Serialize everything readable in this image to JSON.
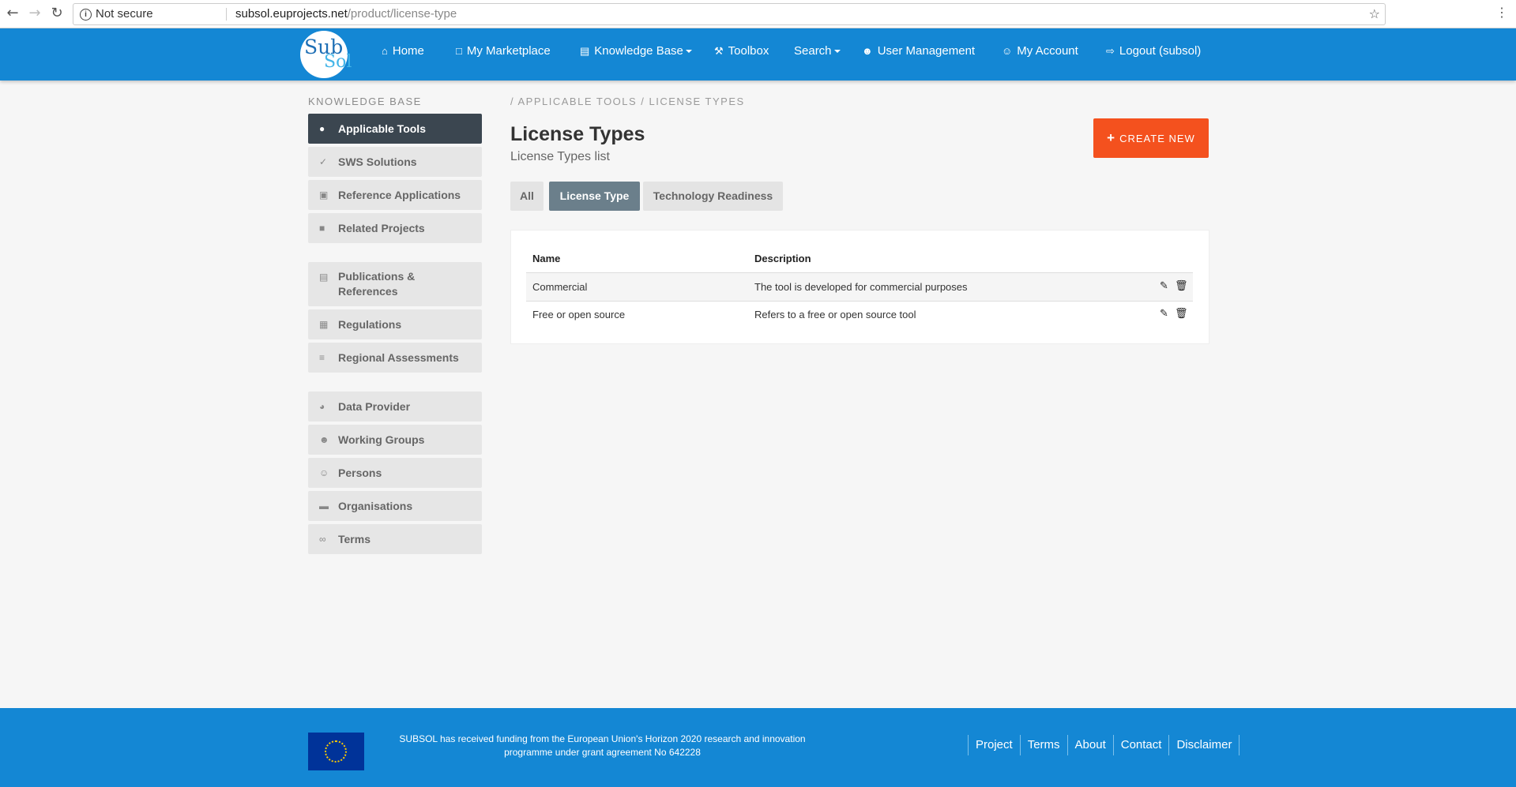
{
  "browser": {
    "security": "Not secure",
    "host": "subsol.euprojects.net",
    "path": "/product/license-type"
  },
  "logo": {
    "part1": "Sub",
    "part2": "Sol"
  },
  "nav": {
    "home": "Home",
    "marketplace": "My Marketplace",
    "knowledge_base": "Knowledge Base",
    "toolbox": "Toolbox",
    "search": "Search",
    "user_management": "User Management",
    "my_account": "My Account",
    "logout": "Logout (subsol)"
  },
  "sidebar": {
    "heading": "KNOWLEDGE BASE",
    "items": [
      {
        "label": "Applicable Tools"
      },
      {
        "label": "SWS Solutions"
      },
      {
        "label": "Reference Applications"
      },
      {
        "label": "Related Projects"
      },
      {
        "label": "Publications & References"
      },
      {
        "label": "Regulations"
      },
      {
        "label": "Regional Assessments"
      },
      {
        "label": "Data Provider"
      },
      {
        "label": "Working Groups"
      },
      {
        "label": "Persons"
      },
      {
        "label": "Organisations"
      },
      {
        "label": "Terms"
      }
    ]
  },
  "main": {
    "breadcrumb": "/ APPLICABLE TOOLS / LICENSE TYPES",
    "title": "License Types",
    "subtitle": "License Types list",
    "create_label": "CREATE NEW",
    "tabs": [
      {
        "label": "All"
      },
      {
        "label": "License Type"
      },
      {
        "label": "Technology Readiness"
      }
    ],
    "table": {
      "headers": {
        "name": "Name",
        "description": "Description"
      },
      "rows": [
        {
          "name": "Commercial",
          "description": "The tool is developed for commercial purposes"
        },
        {
          "name": "Free or open source",
          "description": "Refers to a free or open source tool"
        }
      ]
    }
  },
  "footer": {
    "funding_line1": "SUBSOL has received funding from the European Union's Horizon 2020 research and innovation",
    "funding_line2": "programme under grant agreement No 642228",
    "links": [
      "Project",
      "Terms",
      "About",
      "Contact",
      "Disclaimer"
    ]
  },
  "colors": {
    "nav_blue": "#1487d4",
    "accent_orange": "#f4511e",
    "active_sidebar": "#3b4650",
    "active_tab": "#6b7f8b"
  }
}
